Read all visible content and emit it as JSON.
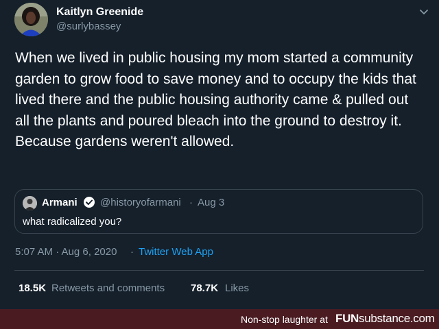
{
  "tweet": {
    "author_name": "Kaitlyn Greenide",
    "author_handle": "@surlybassey",
    "text": "When we lived in public housing my mom started a community garden to grow food to save money and to occupy the kids that lived there and the public housing authority came & pulled out all the plants and poured bleach into the ground to destroy it. Because gardens weren't allowed.",
    "menu_icon": "chevron-down-icon"
  },
  "quoted": {
    "name": "Armani",
    "verified_icon": "verified-badge-icon",
    "handle": "@historyofarmani",
    "separator": "·",
    "date": "Aug 3",
    "text": "what radicalized you?"
  },
  "meta": {
    "time": "5:07 AM · Aug 6, 2020",
    "separator": "·",
    "source": "Twitter Web App"
  },
  "stats": {
    "retweets_count": "18.5K",
    "retweets_label": "Retweets and comments",
    "likes_count": "78.7K",
    "likes_label": "Likes"
  },
  "watermark": {
    "text": "Non-stop laughter at",
    "logo_fun": "FUN",
    "logo_substance": "substance",
    "logo_tld": ".com"
  },
  "colors": {
    "background": "#15202b",
    "secondary_text": "#8899a6",
    "link": "#1da1f2",
    "border": "#38444d",
    "footer_bar": "#4a1c22"
  }
}
